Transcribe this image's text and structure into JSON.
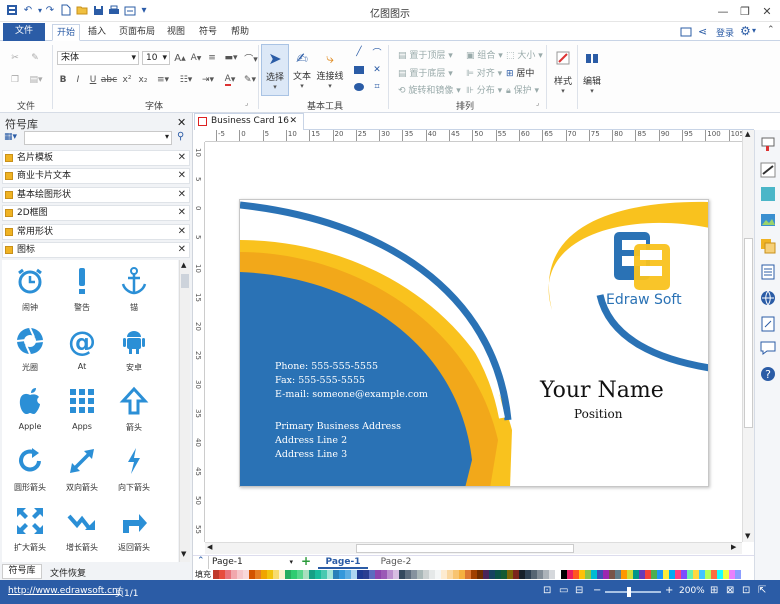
{
  "window": {
    "title": "亿图图示"
  },
  "menu_tabs": [
    "文件",
    "开始",
    "插入",
    "页面布局",
    "视图",
    "符号",
    "帮助"
  ],
  "account": {
    "login": "登录"
  },
  "ribbon": {
    "font_name": "宋体",
    "font_size": "10",
    "groups": {
      "file": "文件",
      "font": "字体",
      "tools": "基本工具",
      "arrange": "排列"
    },
    "tools": {
      "select": "选择",
      "text": "文本",
      "connector": "连接线"
    },
    "arrange": {
      "bring_front": "置于顶层",
      "send_back": "置于底层",
      "rotate_mirror": "旋转和镜像",
      "group": "组合",
      "align": "对齐",
      "distribute": "分布",
      "size": "大小",
      "center": "居中",
      "protect": "保护"
    },
    "style": "样式",
    "edit": "编辑"
  },
  "library": {
    "title": "符号库",
    "categories": [
      "名片模板",
      "商业卡片文本",
      "基本绘图形状",
      "2D框图",
      "常用形状",
      "图标"
    ],
    "symbols": [
      {
        "icon": "alarm-clock-icon",
        "label": "闹钟"
      },
      {
        "icon": "exclamation-icon",
        "label": "警告"
      },
      {
        "icon": "anchor-icon",
        "label": "锚"
      },
      {
        "icon": "aperture-icon",
        "label": "光圈"
      },
      {
        "icon": "at-icon",
        "label": "At"
      },
      {
        "icon": "android-icon",
        "label": "安卓"
      },
      {
        "icon": "apple-icon",
        "label": "Apple"
      },
      {
        "icon": "apps-icon",
        "label": "Apps"
      },
      {
        "icon": "arrow-up-icon",
        "label": "箭头"
      },
      {
        "icon": "circular-arrow-icon",
        "label": "圆形箭头"
      },
      {
        "icon": "two-way-arrow-icon",
        "label": "双向箭头"
      },
      {
        "icon": "down-arrow-icon",
        "label": "向下箭头"
      },
      {
        "icon": "expand-arrow-icon",
        "label": "扩大箭头"
      },
      {
        "icon": "growth-arrow-icon",
        "label": "增长箭头"
      },
      {
        "icon": "return-arrow-icon",
        "label": "返回箭头"
      }
    ],
    "bottom_tabs": [
      "符号库",
      "文件恢复"
    ]
  },
  "document": {
    "tab": "Business Card 16"
  },
  "ruler": {
    "h": [
      "-5",
      "0",
      "5",
      "10",
      "15",
      "20",
      "25",
      "30",
      "35",
      "40",
      "45",
      "50",
      "55",
      "60",
      "65",
      "70",
      "75",
      "80",
      "85",
      "90",
      "95",
      "100",
      "105"
    ],
    "v": [
      "10",
      "5",
      "0",
      "5",
      "10",
      "15",
      "20",
      "25",
      "30",
      "35",
      "40",
      "45",
      "50",
      "55"
    ]
  },
  "card": {
    "phone": "Phone: 555-555-5555",
    "fax": "Fax: 555-555-5555",
    "email": "E-mail: someone@example.com",
    "address_title": "Primary Business Address",
    "address1": "Address Line 2",
    "address2": "Address Line 3",
    "name": "Your Name",
    "position": "Position",
    "brand": "Edraw Soft",
    "colors": {
      "blue": "#2a72b5",
      "yellow": "#f9c21e"
    }
  },
  "pages": {
    "selector": "Page-1",
    "tabs": [
      "Page-1",
      "Page-2"
    ]
  },
  "fill_label": "填充",
  "status": {
    "url": "http://www.edrawsoft.cn/",
    "page": "页1/1",
    "zoom": "200%"
  }
}
